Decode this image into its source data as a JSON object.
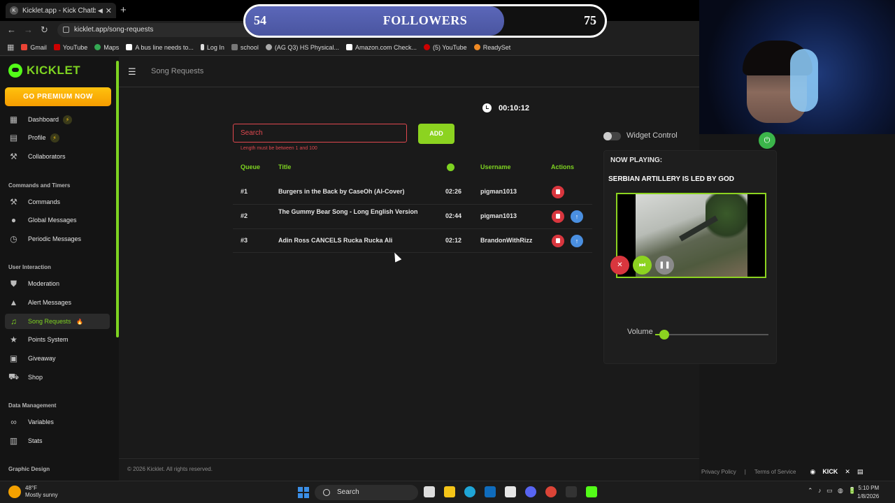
{
  "browser": {
    "tab_title": "Kicklet.app - Kick Chatbot a",
    "url": "kicklet.app/song-requests",
    "bookmarks": [
      "Gmail",
      "YouTube",
      "Maps",
      "A bus line needs to...",
      "Log In",
      "school",
      "(AG Q3) HS Physical...",
      "Amazon.com Check...",
      "(5) YouTube",
      "ReadySet"
    ]
  },
  "followers_overlay": {
    "current": "54",
    "label": "FOLLOWERS",
    "goal": "75",
    "progress": 0.72
  },
  "sidebar": {
    "brand": "KICKLET",
    "premium_label": "GO PREMIUM NOW",
    "items_top": [
      {
        "label": "Dashboard",
        "icon": "dashboard-icon",
        "badge": "⚡"
      },
      {
        "label": "Profile",
        "icon": "profile-icon",
        "badge": "⚡"
      },
      {
        "label": "Collaborators",
        "icon": "collaborators-icon"
      }
    ],
    "section_commands": "Commands and Timers",
    "items_commands": [
      {
        "label": "Commands",
        "icon": "hammer-icon"
      },
      {
        "label": "Global Messages",
        "icon": "chat-bubble-icon"
      },
      {
        "label": "Periodic Messages",
        "icon": "clock-icon"
      }
    ],
    "section_user": "User Interaction",
    "items_user": [
      {
        "label": "Moderation",
        "icon": "shield-icon"
      },
      {
        "label": "Alert Messages",
        "icon": "warning-icon"
      },
      {
        "label": "Song Requests",
        "icon": "music-note-icon",
        "badge": "🔥"
      },
      {
        "label": "Points System",
        "icon": "star-icon"
      },
      {
        "label": "Giveaway",
        "icon": "gift-icon"
      },
      {
        "label": "Shop",
        "icon": "cart-icon"
      }
    ],
    "section_data": "Data Management",
    "items_data": [
      {
        "label": "Variables",
        "icon": "link-icon"
      },
      {
        "label": "Stats",
        "icon": "bar-chart-icon"
      }
    ],
    "section_graphic": "Graphic Design"
  },
  "header": {
    "title": "Song Requests"
  },
  "timer": "00:10:12",
  "search": {
    "placeholder": "Search",
    "error": "Length must be between 1 and 100",
    "add_label": "ADD"
  },
  "table": {
    "headers": {
      "queue": "Queue",
      "title": "Title",
      "username": "Username",
      "actions": "Actions"
    },
    "rows": [
      {
        "queue": "#1",
        "title": "Burgers in the Back by CaseOh (AI-Cover)",
        "duration": "02:26",
        "username": "pigman1013"
      },
      {
        "queue": "#2",
        "title": "The Gummy Bear Song - Long English Version",
        "duration": "02:44",
        "username": "pigman1013"
      },
      {
        "queue": "#3",
        "title": "Adin Ross CANCELS Rucka Rucka Ali",
        "duration": "02:12",
        "username": "BrandonWithRizz"
      }
    ]
  },
  "player": {
    "widget_label": "Widget Control",
    "now_playing_label": "NOW PLAYING:",
    "now_playing_title": "SERBIAN ARTILLERY IS LED BY GOD",
    "volume_label": "Volume",
    "volume": 0.08
  },
  "footer": {
    "copyright": "© 2026 Kicklet. All rights reserved.",
    "privacy": "Privacy Policy",
    "separator": "|",
    "terms": "Terms of Service",
    "social_kick": "KICK"
  },
  "taskbar": {
    "temperature": "48°F",
    "weather": "Mostly sunny",
    "search_label": "Search",
    "time": "5:10 PM",
    "date": "1/8/2026"
  }
}
